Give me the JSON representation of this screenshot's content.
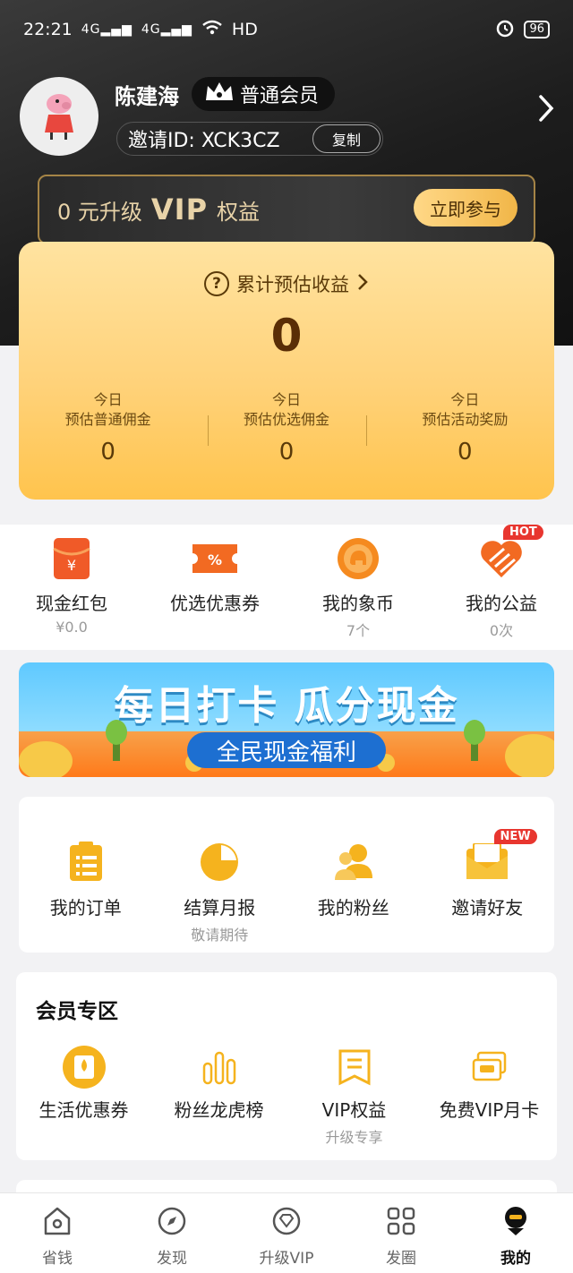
{
  "status_bar": {
    "time": "22:21",
    "signal1": "4G",
    "signal2": "4G",
    "network": "HD",
    "battery": "96"
  },
  "profile": {
    "name": "陈建海",
    "membership": "普通会员",
    "invite_id": "邀请ID: XCK3CZ",
    "copy_label": "复制"
  },
  "vip_banner": {
    "prefix": "0 元升级",
    "vip": "VIP",
    "suffix": "权益",
    "button": "立即参与"
  },
  "earnings": {
    "title": "累计预估收益",
    "total": "0",
    "columns": [
      {
        "line1": "今日",
        "line2": "预估普通佣金",
        "value": "0"
      },
      {
        "line1": "今日",
        "line2": "预估优选佣金",
        "value": "0"
      },
      {
        "line1": "今日",
        "line2": "预估活动奖励",
        "value": "0"
      }
    ]
  },
  "quick": [
    {
      "label": "现金红包",
      "sub": "¥0.0",
      "icon": "red-envelope-icon"
    },
    {
      "label": "优选优惠券",
      "sub": "",
      "icon": "coupon-icon"
    },
    {
      "label": "我的象币",
      "sub": "7个",
      "icon": "elephant-coin-icon"
    },
    {
      "label": "我的公益",
      "sub": "0次",
      "icon": "charity-heart-icon",
      "badge": "HOT"
    }
  ],
  "banner": {
    "title": "每日打卡 瓜分现金",
    "pill": "全民现金福利"
  },
  "tools": [
    {
      "label": "我的订单",
      "sub": "",
      "icon": "order-list-icon"
    },
    {
      "label": "结算月报",
      "sub": "敬请期待",
      "icon": "pie-chart-icon"
    },
    {
      "label": "我的粉丝",
      "sub": "",
      "icon": "fans-icon"
    },
    {
      "label": "邀请好友",
      "sub": "",
      "icon": "invite-envelope-icon",
      "badge": "NEW"
    }
  ],
  "member_zone": {
    "title": "会员专区",
    "items": [
      {
        "label": "生活优惠券",
        "sub": "",
        "icon": "life-coupon-icon"
      },
      {
        "label": "粉丝龙虎榜",
        "sub": "",
        "icon": "ranking-bars-icon"
      },
      {
        "label": "VIP权益",
        "sub": "升级专享",
        "icon": "vip-bookmark-icon"
      },
      {
        "label": "免费VIP月卡",
        "sub": "",
        "icon": "vip-card-icon"
      }
    ]
  },
  "tabs": [
    {
      "label": "省钱",
      "icon": "home-icon",
      "active": false
    },
    {
      "label": "发现",
      "icon": "compass-icon",
      "active": false
    },
    {
      "label": "升级VIP",
      "icon": "vip-diamond-icon",
      "active": false
    },
    {
      "label": "发圈",
      "icon": "grid-icon",
      "active": false
    },
    {
      "label": "我的",
      "icon": "profile-icon",
      "active": true
    }
  ],
  "colors": {
    "accent": "#f2b028",
    "card_gradient_top": "#ffe3a0",
    "card_gradient_bottom": "#ffc44d",
    "badge_red": "#e8362f"
  }
}
